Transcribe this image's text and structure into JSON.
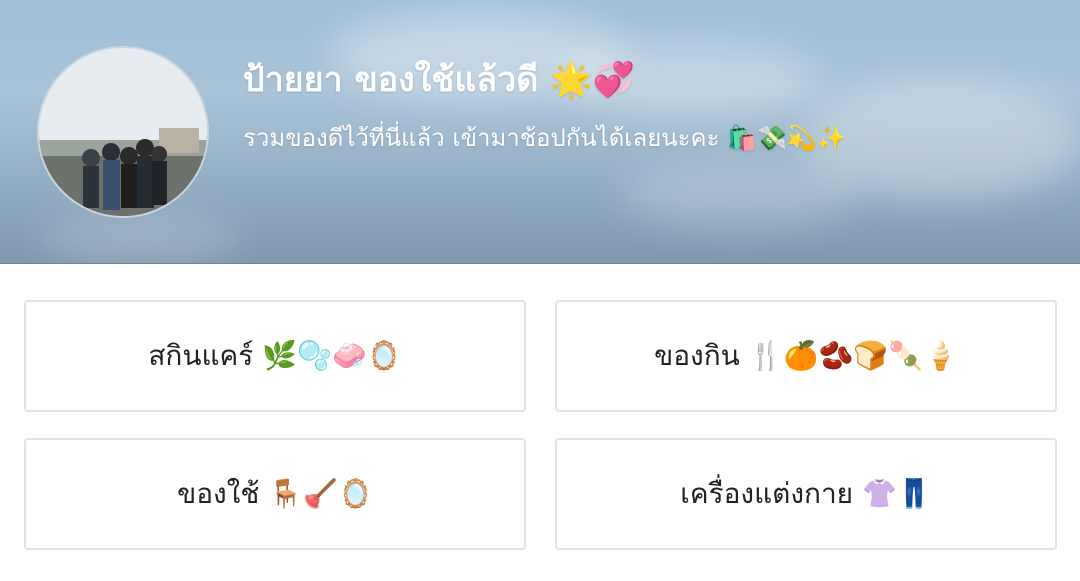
{
  "profile": {
    "title": "ป้ายยา ของใช้แล้วดี 🌟💞",
    "subtitle": "รวมของดีไว้ที่นี่แล้ว เข้ามาช้อปกันได้เลยนะคะ 🛍️💸💫✨"
  },
  "categories": [
    {
      "label": "สกินแคร์ 🌿🫧🧼🪞"
    },
    {
      "label": "ของกิน 🍴🍊🫘🍞🍡🍦"
    },
    {
      "label": "ของใช้ 🪑🪠🪞"
    },
    {
      "label": "เครื่องแต่งกาย 👚👖"
    }
  ]
}
